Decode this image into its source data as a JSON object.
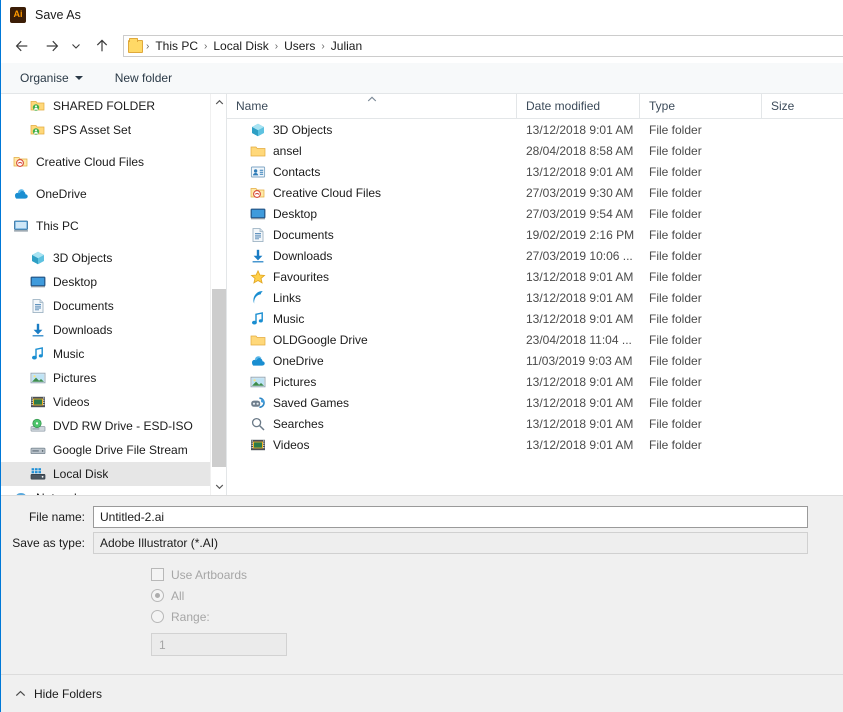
{
  "window": {
    "title": "Save As",
    "app_icon": "illustrator-ai-icon",
    "app_icon_text": "Ai",
    "accent_color": "#0078d7"
  },
  "nav": {
    "back_icon": "arrow-left-icon",
    "forward_icon": "arrow-right-icon",
    "recent_icon": "chevron-down-icon",
    "up_icon": "arrow-up-icon",
    "breadcrumb": [
      "This PC",
      "Local Disk",
      "Users",
      "Julian"
    ],
    "separator": "›"
  },
  "command_bar": {
    "organise_label": "Organise",
    "new_folder_label": "New folder"
  },
  "sidebar": {
    "items": [
      {
        "label": "SHARED FOLDER",
        "icon": "shared-folder-icon",
        "indent": 2,
        "selected": false
      },
      {
        "label": "SPS Asset Set",
        "icon": "shared-folder-icon",
        "indent": 2,
        "selected": false
      },
      {
        "label": "Creative Cloud Files",
        "icon": "creative-cloud-folder-icon",
        "indent": 1,
        "selected": false
      },
      {
        "label": "OneDrive",
        "icon": "onedrive-icon",
        "indent": 1,
        "selected": false
      },
      {
        "label": "This PC",
        "icon": "this-pc-icon",
        "indent": 1,
        "selected": false
      },
      {
        "label": "3D Objects",
        "icon": "3d-objects-icon",
        "indent": 2,
        "selected": false
      },
      {
        "label": "Desktop",
        "icon": "desktop-icon",
        "indent": 2,
        "selected": false
      },
      {
        "label": "Documents",
        "icon": "documents-icon",
        "indent": 2,
        "selected": false
      },
      {
        "label": "Downloads",
        "icon": "downloads-icon",
        "indent": 2,
        "selected": false
      },
      {
        "label": "Music",
        "icon": "music-icon",
        "indent": 2,
        "selected": false
      },
      {
        "label": "Pictures",
        "icon": "pictures-icon",
        "indent": 2,
        "selected": false
      },
      {
        "label": "Videos",
        "icon": "videos-icon",
        "indent": 2,
        "selected": false
      },
      {
        "label": "DVD RW Drive - ESD-ISO",
        "icon": "dvd-drive-icon",
        "indent": 2,
        "selected": false
      },
      {
        "label": "Google Drive File Stream",
        "icon": "drive-icon",
        "indent": 2,
        "selected": false
      },
      {
        "label": "Local Disk",
        "icon": "local-disk-icon",
        "indent": 2,
        "selected": true
      },
      {
        "label": "Network",
        "icon": "network-icon",
        "indent": 1,
        "selected": false
      }
    ],
    "spacers_after": [
      1,
      2,
      3,
      4
    ]
  },
  "file_list": {
    "columns": [
      {
        "key": "name",
        "label": "Name",
        "sorted": true,
        "sort_dir": "asc"
      },
      {
        "key": "date",
        "label": "Date modified"
      },
      {
        "key": "type",
        "label": "Type"
      },
      {
        "key": "size",
        "label": "Size"
      }
    ],
    "rows": [
      {
        "name": "3D Objects",
        "icon": "3d-objects-icon",
        "date": "13/12/2018 9:01 AM",
        "type": "File folder",
        "size": ""
      },
      {
        "name": "ansel",
        "icon": "folder-icon",
        "date": "28/04/2018 8:58 AM",
        "type": "File folder",
        "size": ""
      },
      {
        "name": "Contacts",
        "icon": "contacts-icon",
        "date": "13/12/2018 9:01 AM",
        "type": "File folder",
        "size": ""
      },
      {
        "name": "Creative Cloud Files",
        "icon": "creative-cloud-folder-icon",
        "date": "27/03/2019 9:30 AM",
        "type": "File folder",
        "size": ""
      },
      {
        "name": "Desktop",
        "icon": "desktop-icon",
        "date": "27/03/2019 9:54 AM",
        "type": "File folder",
        "size": ""
      },
      {
        "name": "Documents",
        "icon": "documents-icon",
        "date": "19/02/2019 2:16 PM",
        "type": "File folder",
        "size": ""
      },
      {
        "name": "Downloads",
        "icon": "downloads-icon",
        "date": "27/03/2019 10:06 ...",
        "type": "File folder",
        "size": ""
      },
      {
        "name": "Favourites",
        "icon": "favourites-star-icon",
        "date": "13/12/2018 9:01 AM",
        "type": "File folder",
        "size": ""
      },
      {
        "name": "Links",
        "icon": "links-icon",
        "date": "13/12/2018 9:01 AM",
        "type": "File folder",
        "size": ""
      },
      {
        "name": "Music",
        "icon": "music-icon",
        "date": "13/12/2018 9:01 AM",
        "type": "File folder",
        "size": ""
      },
      {
        "name": "OLDGoogle Drive",
        "icon": "folder-icon",
        "date": "23/04/2018 11:04 ...",
        "type": "File folder",
        "size": ""
      },
      {
        "name": "OneDrive",
        "icon": "onedrive-icon",
        "date": "11/03/2019 9:03 AM",
        "type": "File folder",
        "size": ""
      },
      {
        "name": "Pictures",
        "icon": "pictures-icon",
        "date": "13/12/2018 9:01 AM",
        "type": "File folder",
        "size": ""
      },
      {
        "name": "Saved Games",
        "icon": "saved-games-icon",
        "date": "13/12/2018 9:01 AM",
        "type": "File folder",
        "size": ""
      },
      {
        "name": "Searches",
        "icon": "search-icon",
        "date": "13/12/2018 9:01 AM",
        "type": "File folder",
        "size": ""
      },
      {
        "name": "Videos",
        "icon": "videos-icon",
        "date": "13/12/2018 9:01 AM",
        "type": "File folder",
        "size": ""
      }
    ]
  },
  "form": {
    "file_name_label": "File name:",
    "file_name_value": "Untitled-2.ai",
    "save_as_type_label": "Save as type:",
    "save_as_type_value": "Adobe Illustrator (*.AI)",
    "use_artboards_label": "Use Artboards",
    "use_artboards_checked": false,
    "all_label": "All",
    "all_selected": true,
    "range_label": "Range:",
    "range_selected": false,
    "range_value": "1",
    "options_disabled": true
  },
  "footer": {
    "hide_folders_label": "Hide Folders",
    "hide_folders_icon": "chevron-up-icon"
  }
}
